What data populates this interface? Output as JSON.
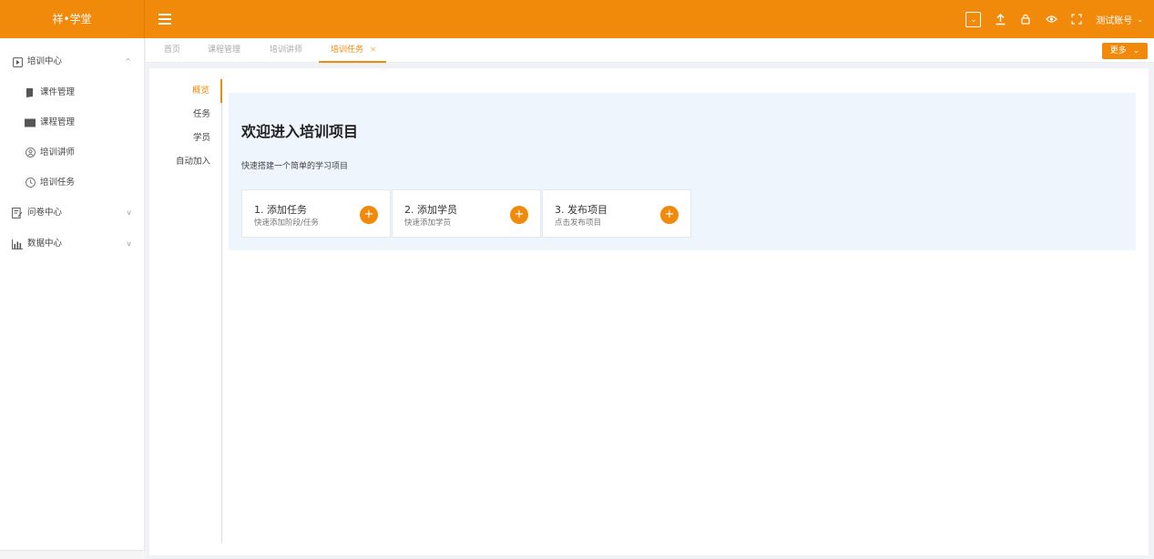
{
  "app": {
    "logo": "祥•学堂"
  },
  "topbar": {
    "user": "测试账号"
  },
  "sidebar": {
    "groups": [
      {
        "label": "培训中心",
        "arrow": "^"
      },
      {
        "label": "问卷中心",
        "arrow": "v"
      },
      {
        "label": "数据中心",
        "arrow": "v"
      }
    ],
    "items": [
      {
        "label": "课件管理"
      },
      {
        "label": "课程管理"
      },
      {
        "label": "培训讲师"
      },
      {
        "label": "培训任务"
      }
    ]
  },
  "tabs": [
    {
      "label": "首页"
    },
    {
      "label": "课程管理"
    },
    {
      "label": "培训讲师"
    },
    {
      "label": "培训任务"
    }
  ],
  "tab_close": "×",
  "more_button": "更多",
  "side_tabs": [
    {
      "label": "概览"
    },
    {
      "label": "任务"
    },
    {
      "label": "学员"
    },
    {
      "label": "自动加入"
    }
  ],
  "panel": {
    "title": "欢迎进入培训项目",
    "subtitle": "快速搭建一个简单的学习项目",
    "cards": [
      {
        "title": "1. 添加任务",
        "desc": "快速添加阶段/任务"
      },
      {
        "title": "2. 添加学员",
        "desc": "快速添加学员"
      },
      {
        "title": "3. 发布项目",
        "desc": "点击发布项目"
      }
    ],
    "plus": "+"
  },
  "colors": {
    "brand": "#f18a0b",
    "panel_bg": "#eef5fd"
  }
}
